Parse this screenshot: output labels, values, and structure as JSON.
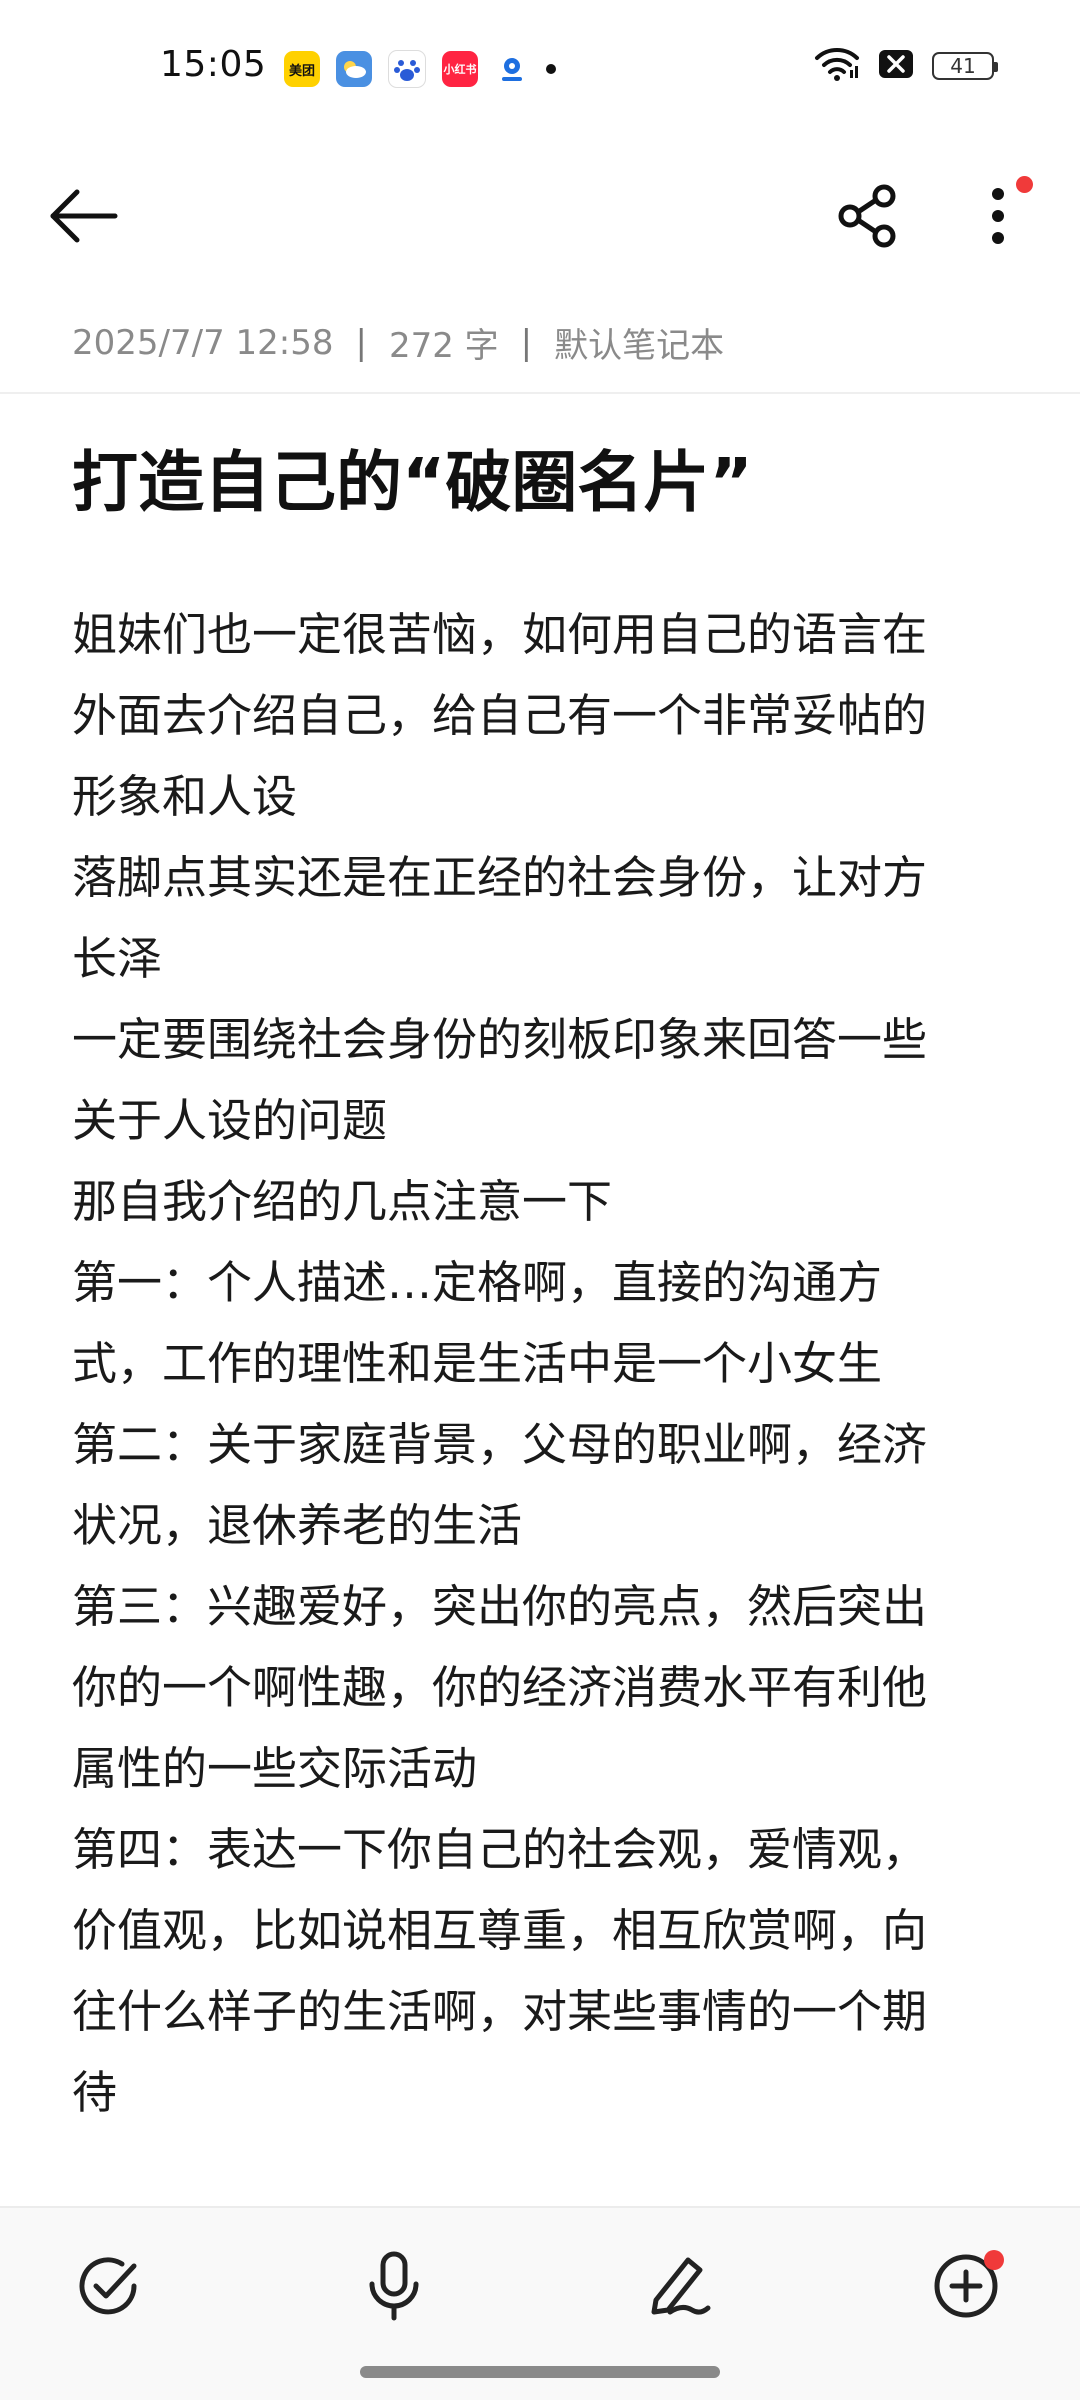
{
  "status_bar": {
    "time": "15:05",
    "app_icons": [
      {
        "name": "meituan-icon",
        "label": "美团"
      },
      {
        "name": "weather-icon",
        "label": ""
      },
      {
        "name": "baidu-icon",
        "label": ""
      },
      {
        "name": "xiaohongshu-icon",
        "label": "小红书"
      },
      {
        "name": "location-icon",
        "label": ""
      }
    ],
    "battery": "41"
  },
  "note": {
    "date": "2025/7/7 12:58",
    "word_count": "272 字",
    "notebook": "默认笔记本",
    "title": "打造自己的“破圈名片”",
    "lines": [
      "姐妹们也一定很苦恼，如何用自己的语言在",
      "外面去介绍自己，给自己有一个非常妥帖的",
      "形象和人设",
      "落脚点其实还是在正经的社会身份，让对方",
      "长泽",
      "一定要围绕社会身份的刻板印象来回答一些",
      "关于人设的问题",
      "那自我介绍的几点注意一下",
      "第一：个人描述…定格啊，直接的沟通方",
      "式，工作的理性和是生活中是一个小女生",
      "第二：关于家庭背景，父母的职业啊，经济",
      "状况，退休养老的生活",
      "第三：兴趣爱好，突出你的亮点，然后突出",
      "你的一个啊性趣，你的经济消费水平有利他",
      "属性的一些交际活动",
      "第四：表达一下你自己的社会观，爱情观，",
      "价值观，比如说相互尊重，相互欣赏啊，向",
      "往什么样子的生活啊，对某些事情的一个期",
      "待"
    ]
  },
  "toolbar": {
    "back_icon": "back-arrow-icon",
    "share_icon": "share-icon",
    "more_icon": "more-vertical-icon"
  },
  "bottom_bar": {
    "check_icon": "checklist-icon",
    "mic_icon": "microphone-icon",
    "pen_icon": "pen-icon",
    "add_icon": "add-icon"
  },
  "colors": {
    "accent_red": "#f03a3a",
    "meta_gray": "#8a8a8a",
    "text": "#1a1a1a"
  }
}
